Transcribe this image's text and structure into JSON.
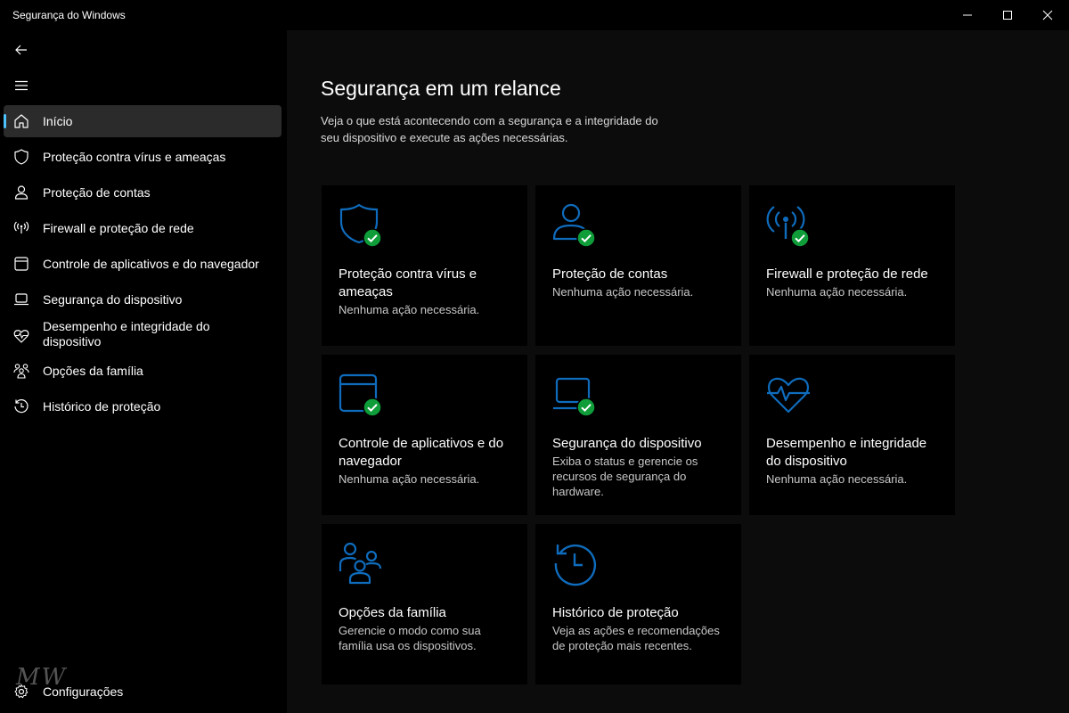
{
  "window": {
    "title": "Segurança do Windows"
  },
  "sidebar": {
    "items": [
      {
        "label": "Início",
        "icon": "home-icon",
        "active": true
      },
      {
        "label": "Proteção contra vírus e ameaças",
        "icon": "shield-icon"
      },
      {
        "label": "Proteção de contas",
        "icon": "person-icon"
      },
      {
        "label": "Firewall e proteção de rede",
        "icon": "wifi-antenna-icon"
      },
      {
        "label": "Controle de aplicativos e do navegador",
        "icon": "app-window-icon"
      },
      {
        "label": "Segurança do dispositivo",
        "icon": "laptop-icon"
      },
      {
        "label": "Desempenho e integridade do dispositivo",
        "icon": "heart-pulse-icon"
      },
      {
        "label": "Opções da família",
        "icon": "family-icon"
      },
      {
        "label": "Histórico de proteção",
        "icon": "history-icon"
      }
    ],
    "settings_label": "Configurações",
    "watermark": "MW"
  },
  "main": {
    "title": "Segurança em um relance",
    "description": "Veja o que está acontecendo com a segurança e a integridade do seu dispositivo e execute as ações necessárias.",
    "cards": [
      {
        "title": "Proteção contra vírus e ameaças",
        "status": "Nenhuma ação necessária.",
        "icon": "shield-icon",
        "ok": true
      },
      {
        "title": "Proteção de contas",
        "status": "Nenhuma ação necessária.",
        "icon": "person-icon",
        "ok": true
      },
      {
        "title": "Firewall e proteção de rede",
        "status": "Nenhuma ação necessária.",
        "icon": "wifi-antenna-icon",
        "ok": true
      },
      {
        "title": "Controle de aplicativos e do navegador",
        "status": "Nenhuma ação necessária.",
        "icon": "app-window-icon",
        "ok": true
      },
      {
        "title": "Segurança do dispositivo",
        "status": "Exiba o status e gerencie os recursos de segurança do hardware.",
        "icon": "laptop-icon",
        "ok": true
      },
      {
        "title": "Desempenho e integridade do dispositivo",
        "status": "Nenhuma ação necessária.",
        "icon": "heart-pulse-icon",
        "ok": false
      },
      {
        "title": "Opções da família",
        "status": "Gerencie o modo como sua família usa os dispositivos.",
        "icon": "family-icon",
        "ok": false
      },
      {
        "title": "Histórico de proteção",
        "status": "Veja as ações e recomendações de proteção mais recentes.",
        "icon": "history-icon",
        "ok": false
      }
    ]
  },
  "colors": {
    "accent": "#0f6cbd",
    "ok_green": "#0f9d3a",
    "nav_indicator": "#4cc2ff"
  }
}
